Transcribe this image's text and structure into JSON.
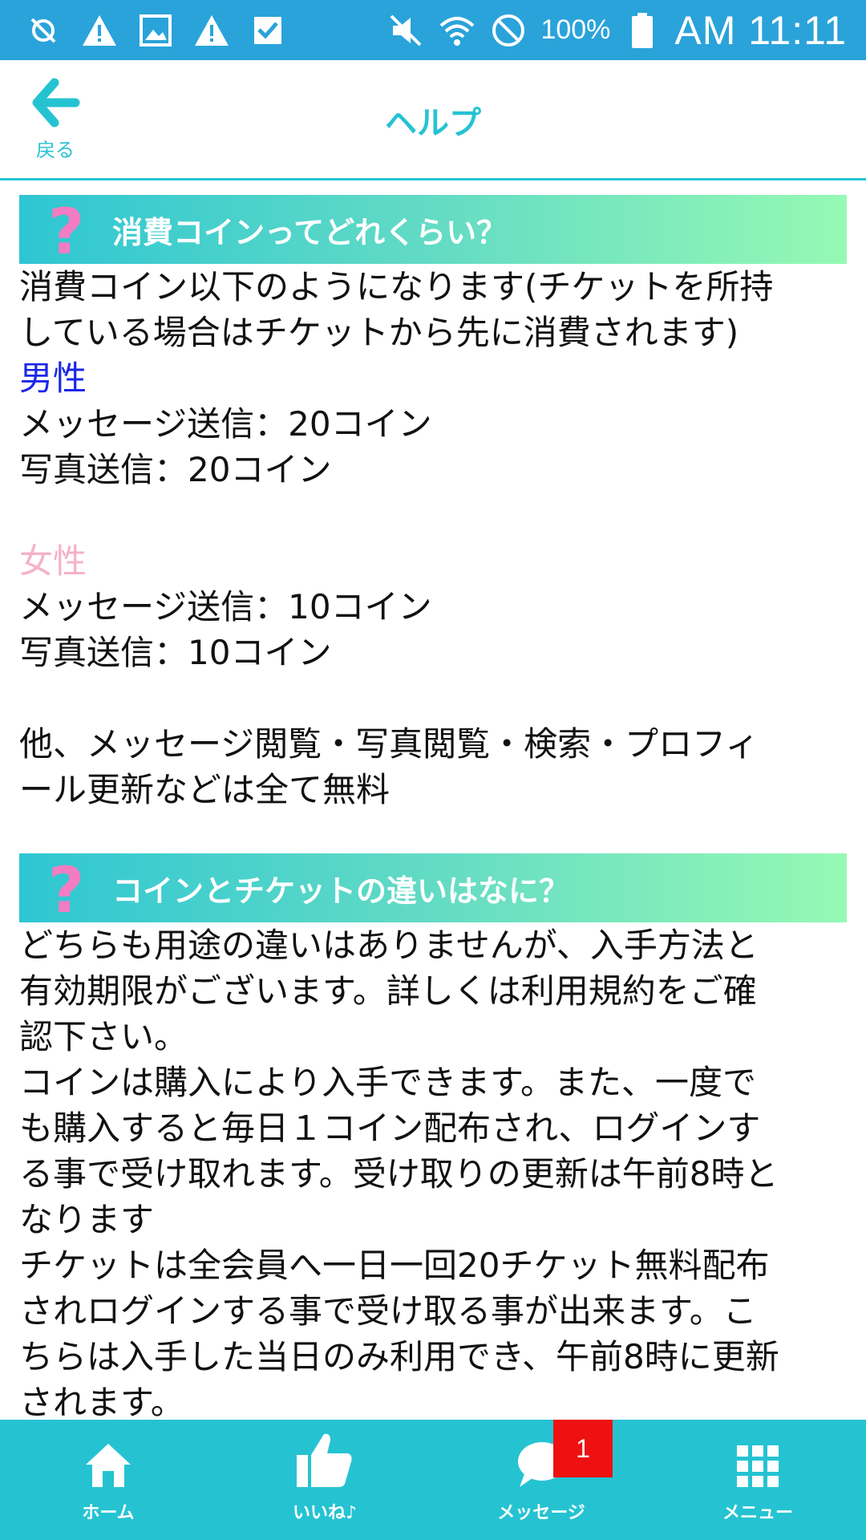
{
  "status_bar": {
    "battery": "100%",
    "time": "AM 11:11",
    "icons": [
      "usb-debug-icon",
      "warning-icon",
      "image-icon",
      "warning-icon",
      "check-icon",
      "mute-icon",
      "wifi-icon",
      "do-not-disturb-icon",
      "battery-icon"
    ],
    "bg_color": "#2aa3da"
  },
  "header": {
    "back_label": "戻る",
    "title": "ヘルプ",
    "accent_color": "#25c3d2"
  },
  "sections": [
    {
      "title": "消費コインってどれくらい？",
      "lines": {
        "intro_1": "消費コイン以下のようになります(チケットを所持",
        "intro_2": "している場合はチケットから先に消費されます)",
        "male": "男性",
        "male_msg": "メッセージ送信：20コイン",
        "male_photo": "写真送信：20コイン",
        "female": "女性",
        "female_msg": "メッセージ送信：10コイン",
        "female_photo": "写真送信：10コイン",
        "free_1": "他、メッセージ閲覧・写真閲覧・検索・プロフィ",
        "free_2": "ール更新などは全て無料"
      }
    },
    {
      "title": "コインとチケットの違いはなに？",
      "lines": [
        "どちらも用途の違いはありませんが、入手方法と",
        "有効期限がございます。詳しくは利用規約をご確",
        "認下さい。",
        "コインは購入により入手できます。また、一度で",
        "も購入すると毎日１コイン配布され、ログインす",
        "る事で受け取れます。受け取りの更新は午前8時と",
        "なります",
        "チケットは全会員へ一日一回20チケット無料配布",
        "されログインする事で受け取る事が出来ます。こ",
        "ちらは入手した当日のみ利用でき、午前8時に更新",
        "されます。"
      ]
    }
  ],
  "bottom_nav": {
    "home": "ホーム",
    "like": "いいね♪",
    "message": "メッセージ",
    "menu": "メニュー",
    "message_badge": "1",
    "bg_color": "#25c3d2"
  }
}
